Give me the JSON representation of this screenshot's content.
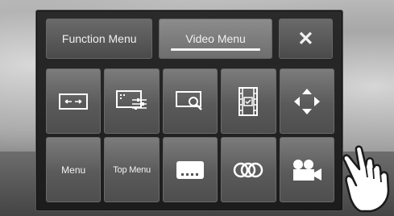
{
  "tabs": {
    "function_menu": "Function Menu",
    "video_menu": "Video Menu",
    "close": "✕"
  },
  "buttons_row1": [
    {
      "name": "aspect-ratio-icon"
    },
    {
      "name": "picture-adjust-icon"
    },
    {
      "name": "zoom-icon"
    },
    {
      "name": "film-clip-icon"
    },
    {
      "name": "cursor-arrows-icon"
    }
  ],
  "buttons_row2": {
    "menu": "Menu",
    "top_menu": "Top Menu",
    "subtitle_icon": "subtitle-icon",
    "audio_icon": "audio-channel-icon",
    "angle_icon": "camera-angle-icon"
  },
  "colors": {
    "panel": "#1e1e1e",
    "button": "#5c5c5c",
    "active_tab": "#7a7a7a"
  }
}
